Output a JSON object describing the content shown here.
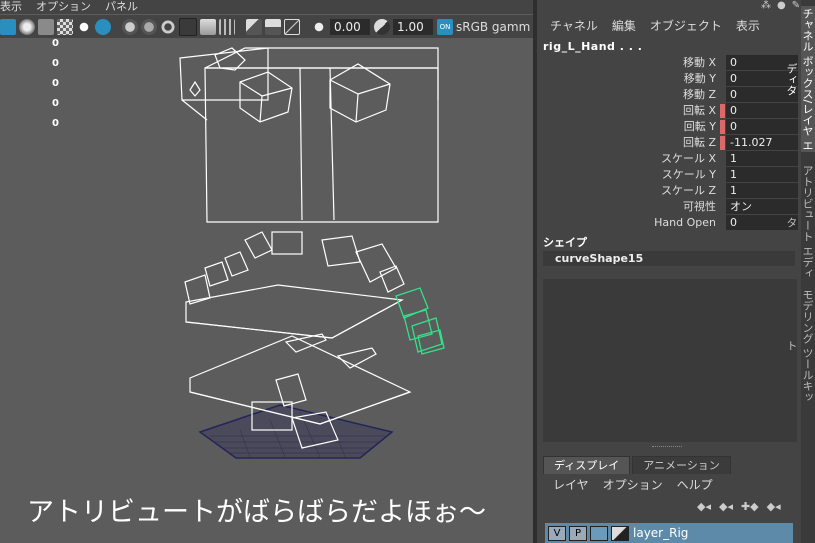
{
  "viewport": {
    "menu": [
      "表示",
      "オプション",
      "パネル"
    ],
    "toolbar": {
      "exposure": "0.00",
      "gamma": "1.00",
      "colorspace": "sRGB gamm"
    },
    "counts": [
      "0",
      "0",
      "0",
      "0",
      "0"
    ],
    "caption": "アトリビュートがばらばらだよほぉ～"
  },
  "channel_box": {
    "menu": [
      "チャネル",
      "編集",
      "オブジェクト",
      "表示"
    ],
    "object_name": "rig_L_Hand . . .",
    "attributes": [
      {
        "label": "移動 X",
        "value": "0",
        "keyed": false
      },
      {
        "label": "移動 Y",
        "value": "0",
        "keyed": false
      },
      {
        "label": "移動 Z",
        "value": "0",
        "keyed": false
      },
      {
        "label": "回転 X",
        "value": "0",
        "keyed": true
      },
      {
        "label": "回転 Y",
        "value": "0",
        "keyed": true
      },
      {
        "label": "回転 Z",
        "value": "-11.027",
        "keyed": true
      },
      {
        "label": "スケール X",
        "value": "1",
        "keyed": false
      },
      {
        "label": "スケール Y",
        "value": "1",
        "keyed": false
      },
      {
        "label": "スケール Z",
        "value": "1",
        "keyed": false
      },
      {
        "label": "可視性",
        "value": "オン",
        "keyed": false
      },
      {
        "label": "Hand Open",
        "value": "0",
        "keyed": false
      }
    ],
    "shape_header": "シェイプ",
    "shape_name": "curveShape15"
  },
  "layer_editor": {
    "tabs": [
      "ディスプレイ",
      "アニメーション"
    ],
    "menu": [
      "レイヤ",
      "オプション",
      "ヘルプ"
    ],
    "layer": {
      "v": "V",
      "p": "P",
      "name": "layer_Rig"
    }
  },
  "side_tabs": [
    "チャネル ボックス/レイヤ エディタ",
    "アトリビュート エディタ",
    "モデリング ツールキット"
  ],
  "colors": {
    "keyed": "#d96a6a",
    "selected_curve": "#35e08a",
    "grid": "#26264a",
    "layer_row": "#5d8aa8"
  }
}
